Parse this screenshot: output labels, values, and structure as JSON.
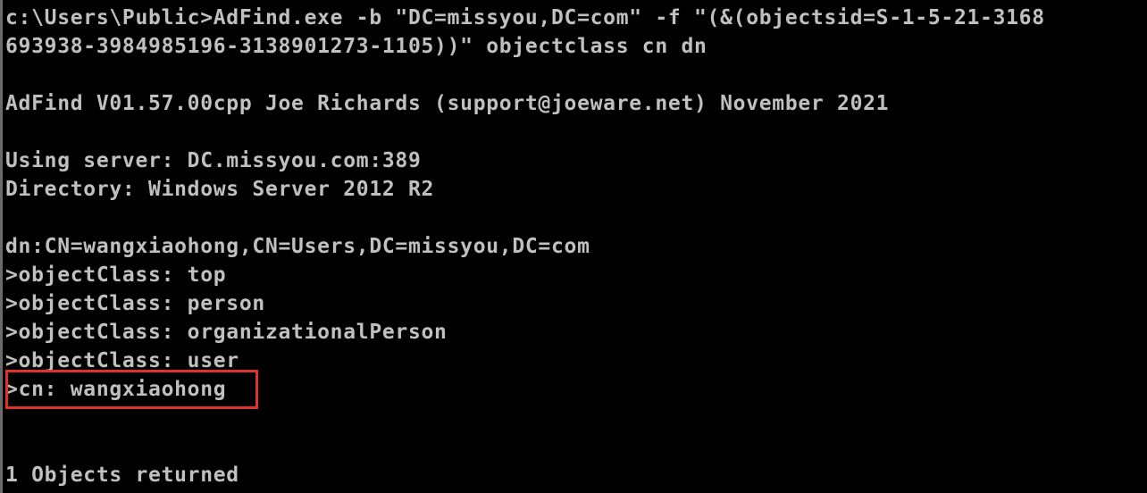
{
  "terminal": {
    "background": "#000000",
    "text_color": "#c0c0c0",
    "highlight_color": "#e0312a",
    "lines": [
      "c:\\Users\\Public>AdFind.exe -b \"DC=missyou,DC=com\" -f \"(&(objectsid=S-1-5-21-3168",
      "693938-3984985196-3138901273-1105))\" objectclass cn dn",
      "",
      "AdFind V01.57.00cpp Joe Richards (support@joeware.net) November 2021",
      "",
      "Using server: DC.missyou.com:389",
      "Directory: Windows Server 2012 R2",
      "",
      "dn:CN=wangxiaohong,CN=Users,DC=missyou,DC=com",
      ">objectClass: top",
      ">objectClass: person",
      ">objectClass: organizationalPerson",
      ">objectClass: user",
      ">cn: wangxiaohong",
      "",
      "",
      "1 Objects returned"
    ]
  }
}
